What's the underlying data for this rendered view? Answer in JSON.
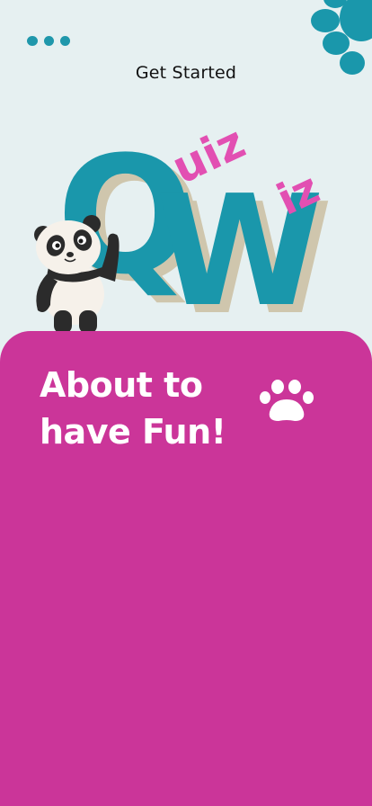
{
  "header": {
    "title": "Get Started"
  },
  "logo": {
    "letters": [
      "Q",
      "W"
    ],
    "upper_text": "uiz",
    "lower_text": "iz"
  },
  "card": {
    "headline_line1": "About to",
    "headline_line2": "have Fun!"
  },
  "colors": {
    "background": "#e6f0f1",
    "teal": "#1a97ab",
    "pink": "#e24fb2",
    "card": "#cb3599",
    "shadow": "#cfc6ad"
  },
  "icons": {
    "status": "dots-icon",
    "top_decoration": "paw-print-icon",
    "card_decoration": "paw-print-icon",
    "mascot": "panda-mascot"
  }
}
